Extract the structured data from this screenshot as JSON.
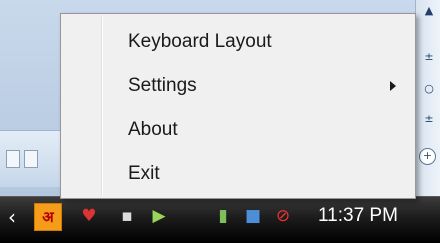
{
  "context_menu": {
    "items": [
      {
        "label": "Keyboard Layout",
        "has_submenu": false
      },
      {
        "label": "Settings",
        "has_submenu": true
      },
      {
        "label": "About",
        "has_submenu": false
      },
      {
        "label": "Exit",
        "has_submenu": false
      }
    ]
  },
  "taskbar": {
    "clock": "11:37 PM",
    "language_indicator": "अ",
    "show_hidden_icons_glyph": "‹",
    "tray_icons": [
      "hindi-input-icon",
      "heart-icon",
      "flag-icon",
      "media-player-icon",
      "network-icon",
      "monitor-icon",
      "volume-muted-icon"
    ]
  },
  "background_window": {
    "scrollbar_glyphs": {
      "up": "▲",
      "mid_a": "±",
      "mid_b": "○",
      "mid_c": "±"
    }
  },
  "colors": {
    "menu_background": "#f0f0f0",
    "menu_border": "#979797",
    "taskbar": "#1c1c1c",
    "clock_text": "#ffffff"
  }
}
